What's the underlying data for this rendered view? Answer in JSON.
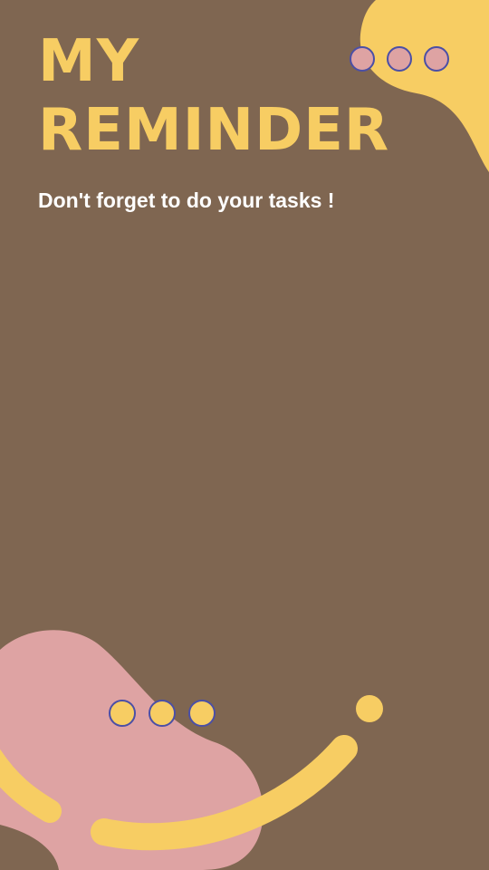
{
  "title": {
    "line1": "MY",
    "line2": "REMINDER"
  },
  "subtitle": "Don't forget to do your tasks !",
  "colors": {
    "background": "#7f6651",
    "accent_yellow": "#f7cd63",
    "accent_pink": "#dea3a3",
    "dot_outline": "#4b4fa6"
  }
}
